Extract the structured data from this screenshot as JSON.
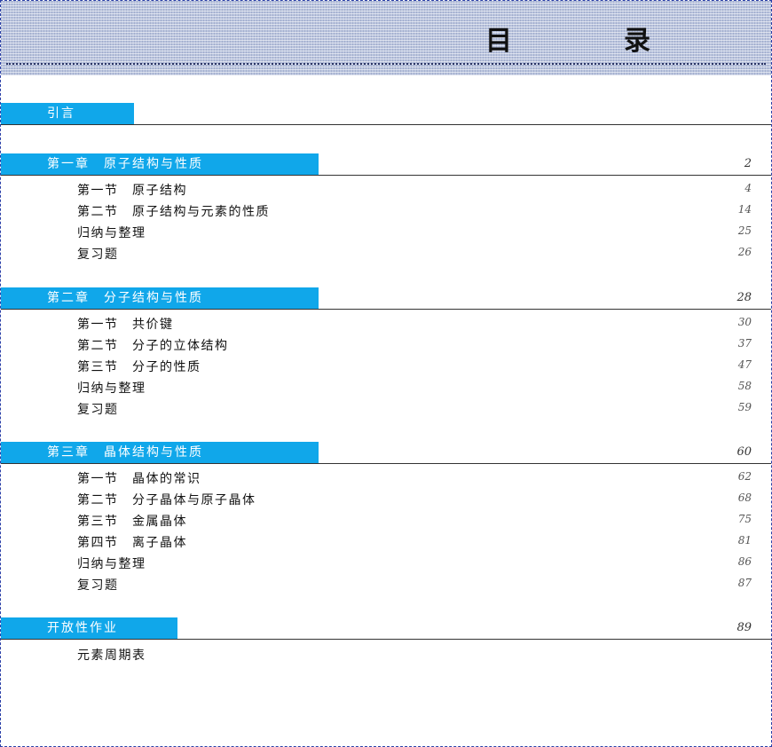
{
  "title": "目　录",
  "intro": {
    "label": "引言"
  },
  "chapters": [
    {
      "label": "第一章　原子结构与性质",
      "page": "2",
      "items": [
        {
          "label": "第一节　原子结构",
          "page": "4"
        },
        {
          "label": "第二节　原子结构与元素的性质",
          "page": "14"
        },
        {
          "label": "归纳与整理",
          "page": "25"
        },
        {
          "label": "复习题",
          "page": "26"
        }
      ]
    },
    {
      "label": "第二章　分子结构与性质",
      "page": "28",
      "items": [
        {
          "label": "第一节　共价键",
          "page": "30"
        },
        {
          "label": "第二节　分子的立体结构",
          "page": "37"
        },
        {
          "label": "第三节　分子的性质",
          "page": "47"
        },
        {
          "label": "归纳与整理",
          "page": "58"
        },
        {
          "label": "复习题",
          "page": "59"
        }
      ]
    },
    {
      "label": "第三章　晶体结构与性质",
      "page": "60",
      "items": [
        {
          "label": "第一节　晶体的常识",
          "page": "62"
        },
        {
          "label": "第二节　分子晶体与原子晶体",
          "page": "68"
        },
        {
          "label": "第三节　金属晶体",
          "page": "75"
        },
        {
          "label": "第四节　离子晶体",
          "page": "81"
        },
        {
          "label": "归纳与整理",
          "page": "86"
        },
        {
          "label": "复习题",
          "page": "87"
        }
      ]
    }
  ],
  "homework": {
    "label": "开放性作业",
    "page": "89",
    "items": [
      {
        "label": "元素周期表"
      }
    ]
  }
}
